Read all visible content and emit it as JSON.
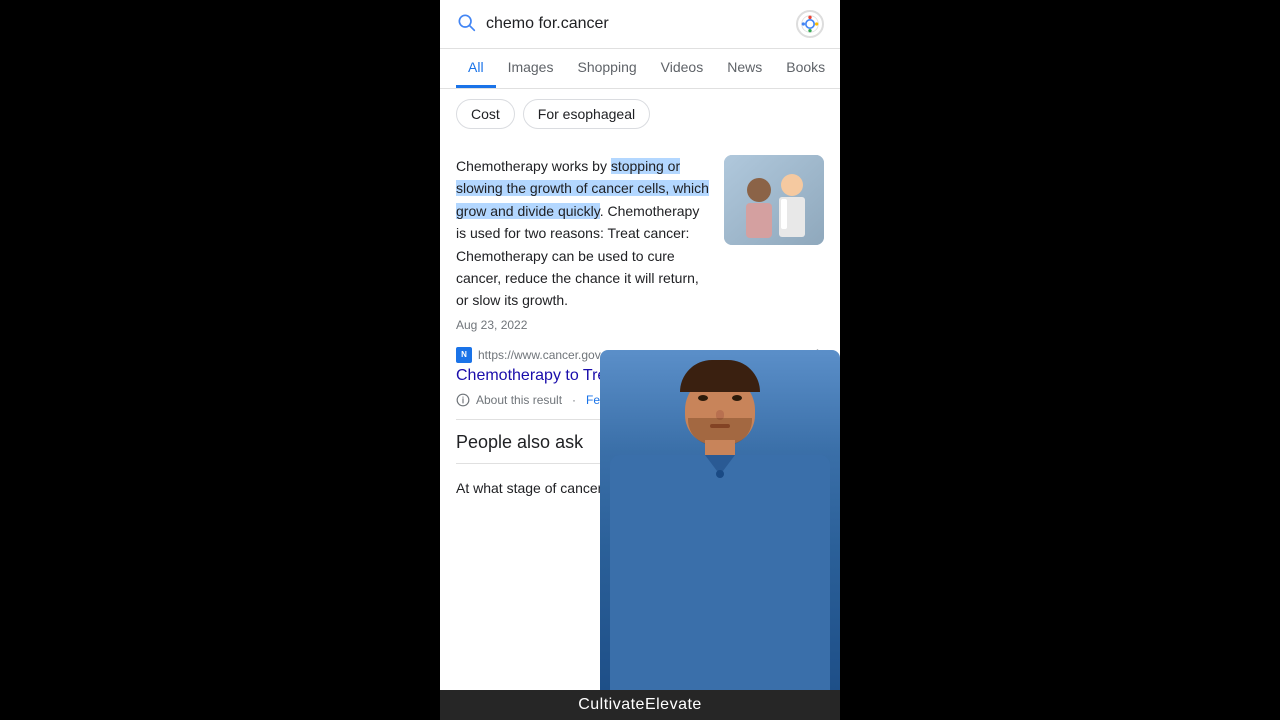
{
  "search": {
    "query": "chemo for.cancer",
    "placeholder": "chemo for cancer"
  },
  "tabs": [
    {
      "label": "All",
      "active": true
    },
    {
      "label": "Images",
      "active": false
    },
    {
      "label": "Shopping",
      "active": false
    },
    {
      "label": "Videos",
      "active": false
    },
    {
      "label": "News",
      "active": false
    },
    {
      "label": "Books",
      "active": false
    }
  ],
  "filters": [
    {
      "label": "Cost"
    },
    {
      "label": "For esophageal"
    }
  ],
  "result": {
    "text_intro": "Chemotherapy works by ",
    "text_highlight": "stopping or slowing the growth of cancer cells, which grow and divide quickly",
    "text_continuation": ". Chemotherapy is used for two reasons: Treat cancer: Chemotherapy can be used to cure cancer, reduce the chance it will return, or slow its growth.",
    "date": "Aug 23, 2022",
    "source_url": "https://www.cancer.gov › types › c...",
    "source_favicon_text": "N",
    "link_text": "Chemotherapy to Treat Ca...| NCI",
    "about_text": "About this result",
    "feedback_text": "Feedback"
  },
  "paa": {
    "title": "People also ask",
    "question1": "At what stage of cancer is chemo used?"
  },
  "brand": {
    "name": "CultivateElevate"
  }
}
